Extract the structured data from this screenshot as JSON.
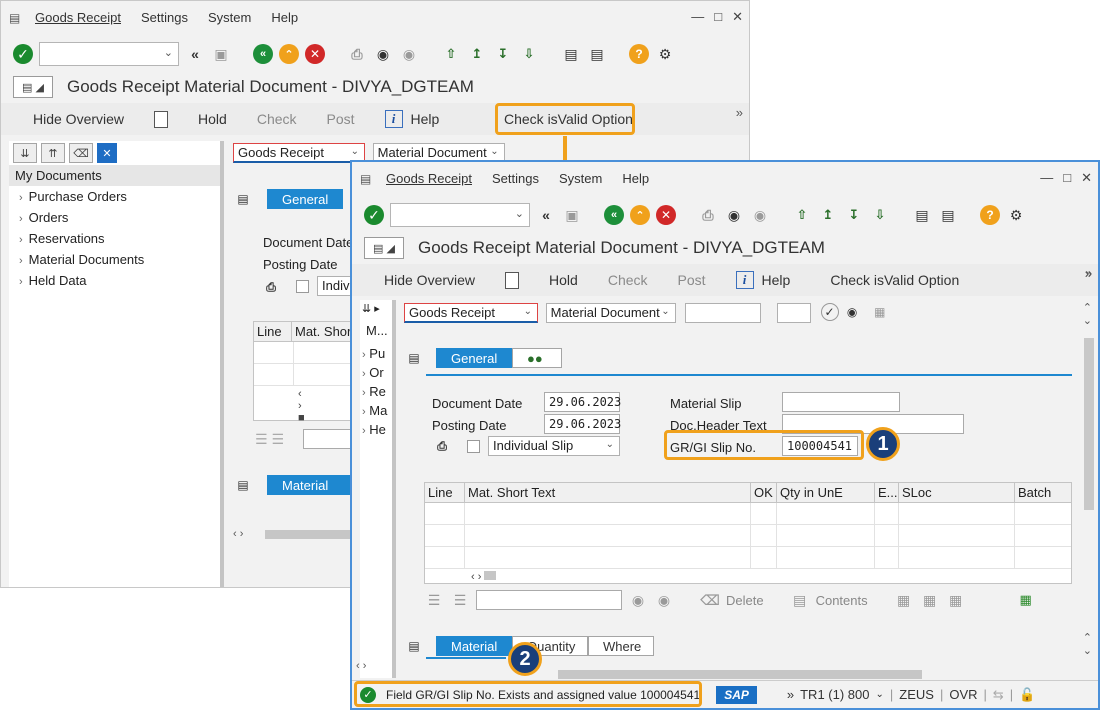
{
  "menu": {
    "goods_receipt": "Goods Receipt",
    "settings": "Settings",
    "system": "System",
    "help": "Help"
  },
  "title": "Goods Receipt Material Document - DIVYA_DGTEAM",
  "app_toolbar": {
    "hide_overview": "Hide Overview",
    "hold": "Hold",
    "check": "Check",
    "post": "Post",
    "help": "Help",
    "check_isvalid": "Check isValid Option"
  },
  "left_pane": {
    "header": "My Documents",
    "header_short": "M...",
    "items": [
      "Purchase Orders",
      "Orders",
      "Reservations",
      "Material Documents",
      "Held Data"
    ],
    "items_short": [
      "Pu",
      "Or",
      "Re",
      "Ma",
      "He"
    ]
  },
  "selectors": {
    "transaction": "Goods Receipt",
    "reference": "Material Document"
  },
  "tabs": {
    "general": "General",
    "material": "Material",
    "quantity": "Quantity",
    "where": "Where"
  },
  "header_fields": {
    "document_date_label": "Document Date",
    "document_date": "29.06.2023",
    "posting_date_label": "Posting Date",
    "posting_date": "29.06.2023",
    "slip_type": "Individual Slip",
    "slip_type_short": "Indivi",
    "material_slip_label": "Material Slip",
    "doc_header_text_label": "Doc.Header Text",
    "grgi_slip_label": "GR/GI Slip No.",
    "grgi_slip_value": "100004541"
  },
  "items_table": {
    "columns": [
      "Line",
      "Mat. Short Text",
      "OK",
      "Qty in UnE",
      "E...",
      "SLoc",
      "Batch"
    ],
    "back_columns": [
      "Line",
      "Mat. Short"
    ]
  },
  "table_toolbar": {
    "delete": "Delete",
    "contents": "Contents"
  },
  "status": {
    "message": "Field GR/GI Slip No. Exists and assigned value 100004541",
    "sap_logo": "SAP",
    "system": "TR1 (1) 800",
    "server": "ZEUS",
    "mode": "OVR"
  },
  "badges": [
    "1",
    "2"
  ],
  "colors": {
    "highlight": "#f0a11c",
    "badge": "#1a3f7a",
    "accent": "#1e88d0",
    "frame": "#4a90d9"
  }
}
